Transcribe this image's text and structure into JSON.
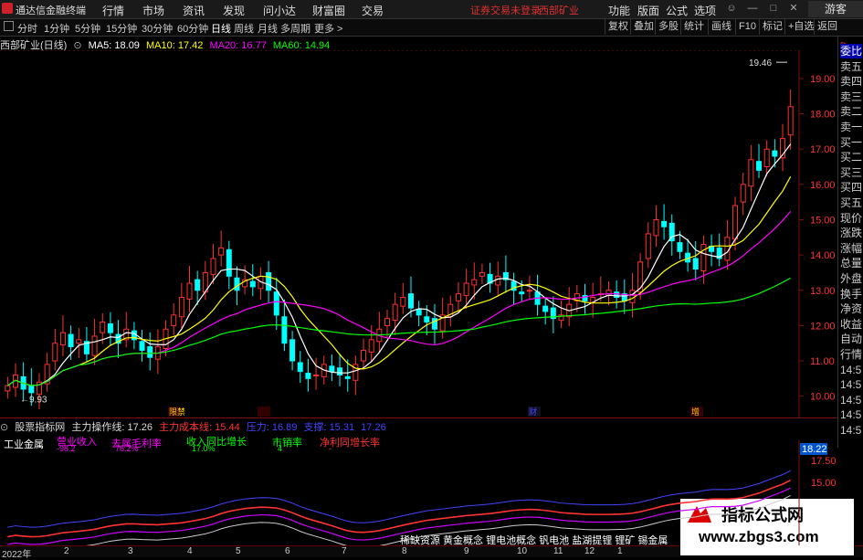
{
  "app": {
    "title": "通达信金融终端",
    "guest_label": "游客"
  },
  "menu": [
    "行情",
    "市场",
    "资讯",
    "发现",
    "问小达",
    "财富圈",
    "交易"
  ],
  "alert": {
    "text": "证券交易未登录",
    "stock": "西部矿业"
  },
  "right_menu": [
    "功能",
    "版面",
    "公式",
    "选项"
  ],
  "periods": [
    "分时",
    "1分钟",
    "5分钟",
    "15分钟",
    "30分钟",
    "60分钟",
    "日线",
    "周线",
    "月线",
    "多周期",
    "更多 >"
  ],
  "active_period": "日线",
  "toolbar": [
    "复权",
    "叠加",
    "多股",
    "统计",
    "画线",
    "F10",
    "标记",
    "+自选",
    "返回"
  ],
  "stock_info": {
    "name": "西部矿业(日线)",
    "ma5": "MA5: 18.09",
    "ma10": "MA10: 17.42",
    "ma20": "MA20: 16.77",
    "ma60": "MA60: 14.94"
  },
  "right_panel": [
    "委比",
    "卖五",
    "卖四",
    "卖三",
    "卖二",
    "卖一",
    "买一",
    "买二",
    "买三",
    "买四",
    "买五",
    "现价",
    "涨跌",
    "涨幅",
    "总量",
    "外盘",
    "换手",
    "净资",
    "收益",
    "自动",
    "行情",
    "14:5",
    "14:5",
    "14:5",
    "14:5",
    "14:5"
  ],
  "right_panel_top": "R",
  "annotations": {
    "high": "19.46",
    "low": "9.93",
    "events": [
      "限禁",
      "",
      "财",
      "增"
    ]
  },
  "indicator": {
    "name": "股票指标网",
    "main": "主力操作线: 17.26",
    "cost": "主力成本线: 15.44",
    "a": "压力: 16.89",
    "b": "支撑: 15.31",
    "c": "17.26"
  },
  "sub_labels": {
    "industry": "工业金属",
    "rev": "营业收入",
    "margin": "去属毛利率",
    "growth": "收入同比增长",
    "l4": "市销率",
    "l5": "净利同增长率",
    "v1": "-98.2",
    "v2": "76.2%",
    "v3": "17.0%",
    "v4": "4",
    "v5": "-"
  },
  "concepts": "稀缺资源 黄金概念 锂电池概念 钒电池 盐湖提锂 锂矿 锡金属",
  "date_labels": [
    "2022年",
    "2",
    "3",
    "4",
    "5",
    "6",
    "7",
    "8",
    "9",
    "10",
    "11",
    "12",
    "1"
  ],
  "watermark": {
    "line1": "指标公式网",
    "line2": "www.zbgs3.com"
  },
  "colors": {
    "up": "#ff3030",
    "down": "#00ffff",
    "ma5": "#ffffff",
    "ma10": "#ffff00",
    "ma20": "#ff00ff",
    "ma60": "#00ff00"
  },
  "chart_data": {
    "type": "candlestick",
    "x_label_axis": "date",
    "ylim": [
      9.5,
      19.8
    ],
    "y_ticks": [
      10.0,
      11.0,
      12.0,
      13.0,
      14.0,
      15.0,
      16.0,
      17.0,
      18.0,
      19.0
    ],
    "close": [
      10.3,
      10.6,
      10.2,
      10.1,
      10.4,
      10.9,
      11.5,
      11.8,
      11.4,
      11.6,
      11.2,
      11.7,
      12.1,
      11.8,
      11.5,
      11.9,
      11.6,
      11.3,
      11.1,
      11.4,
      11.9,
      12.3,
      12.8,
      13.2,
      13.0,
      13.5,
      13.9,
      14.2,
      13.4,
      13.0,
      13.3,
      13.1,
      13.4,
      13.0,
      12.3,
      11.5,
      11.0,
      10.7,
      10.5,
      10.6,
      10.9,
      10.7,
      10.6,
      10.5,
      10.9,
      11.3,
      11.6,
      11.9,
      12.2,
      12.6,
      12.8,
      12.5,
      12.3,
      12.1,
      11.9,
      12.3,
      12.6,
      12.9,
      13.2,
      13.3,
      13.5,
      13.2,
      13.4,
      13.3,
      13.0,
      12.9,
      13.0,
      12.6,
      12.4,
      12.2,
      12.3,
      12.6,
      12.9,
      12.7,
      12.8,
      12.9,
      13.0,
      12.8,
      12.7,
      13.0,
      13.8,
      14.6,
      15.0,
      14.8,
      14.4,
      14.1,
      13.8,
      13.6,
      14.3,
      14.1,
      13.9,
      14.5,
      15.4,
      16.0,
      16.7,
      16.4,
      17.0,
      16.8,
      17.3,
      18.2
    ]
  }
}
